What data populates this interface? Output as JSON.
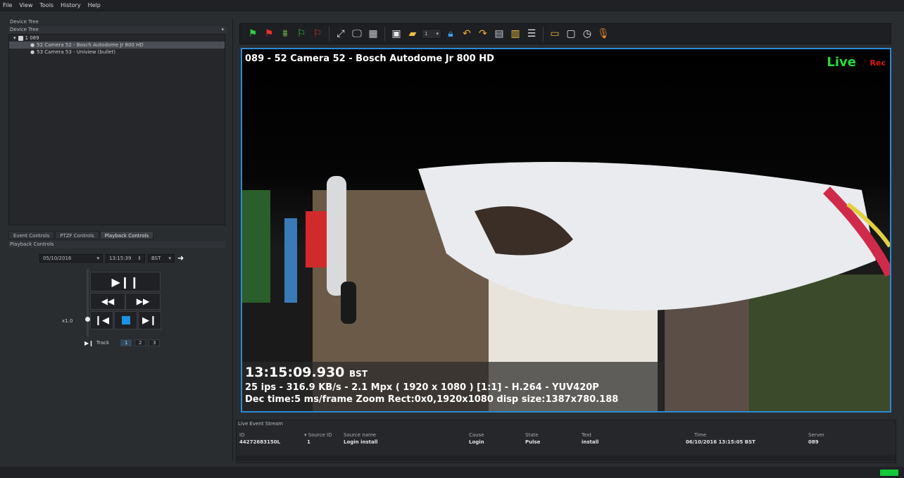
{
  "menu": [
    "File",
    "View",
    "Tools",
    "History",
    "Help"
  ],
  "device_tree": {
    "panel_title": "Device Tree",
    "header": "Device Tree",
    "items": [
      {
        "label": "1 089"
      },
      {
        "label": "52 Camera 52 - Bosch Autodome Jr 800 HD"
      },
      {
        "label": "53 Camera 53 - Uniview (bullet)"
      }
    ]
  },
  "tabs": [
    "Event Controls",
    "PTZF Controls",
    "Playback Controls"
  ],
  "playback": {
    "title": "Playback Controls",
    "date": "05/10/2016",
    "time": "13:15:39",
    "timezone": "BST",
    "speed": "x1.0",
    "track_label": "Track",
    "tracks": [
      "1",
      "2",
      "3"
    ]
  },
  "toolbar": {
    "dropdown_value": "1"
  },
  "video": {
    "title": "089 - 52 Camera 52 - Bosch Autodome Jr 800 HD",
    "live_label": "Live",
    "rec_label": "Rec",
    "time": "13:15:09.930",
    "tz": "BST",
    "stats_line": "25 ips  -  316.9 KB/s  -  2.1 Mpx  ( 1920 x 1080 ) [1:1] -  H.264  -  YUV420P",
    "dec_line": "Dec time:5 ms/frame  Zoom Rect:0x0,1920x1080   disp size:1387x780.188"
  },
  "event_stream": {
    "title": "Live Event Stream",
    "columns": [
      "ID",
      "Source ID",
      "Source name",
      "Cause",
      "State",
      "Text",
      "Time",
      "Server"
    ],
    "rows": [
      [
        "44272683150L",
        "1",
        "Login install",
        "Login",
        "Pulse",
        "install",
        "06/10/2016 13:15:05 BST",
        "089"
      ]
    ]
  },
  "colors": {
    "accent": "#2a8ad4",
    "live": "#22dd33",
    "rec": "#e01818",
    "status_ok": "#12c93a"
  }
}
